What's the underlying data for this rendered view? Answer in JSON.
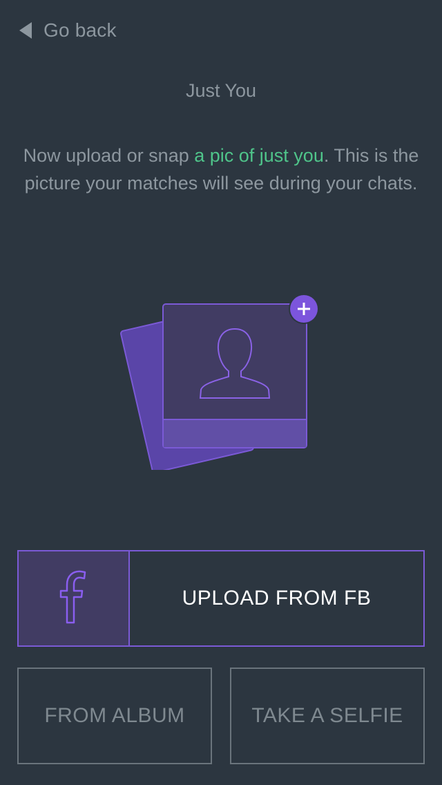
{
  "nav": {
    "back_label": "Go back"
  },
  "header": {
    "title": "Just You"
  },
  "description": {
    "before": "Now upload or snap ",
    "highlight": "a pic of just you",
    "after": ". This is the picture your matches will see during your chats."
  },
  "colors": {
    "background": "#2c3640",
    "accent_purple": "#7b5ad6",
    "highlight_green": "#4fc48a",
    "muted_text": "#8d979f"
  },
  "actions": {
    "upload_fb_label": "UPLOAD FROM FB",
    "upload_fb_icon": "facebook-icon",
    "from_album_label": "FROM ALBUM",
    "take_selfie_label": "TAKE A SELFIE"
  }
}
